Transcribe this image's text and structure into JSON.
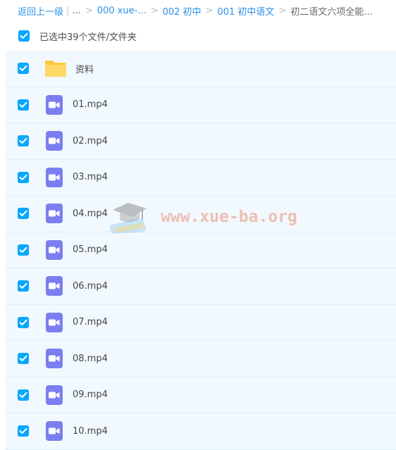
{
  "breadcrumb": {
    "back": "返回上一级",
    "bar": "|",
    "ellipsis": "...",
    "sep": ">",
    "items": [
      "000 xue-...",
      "002 初中",
      "001 初中语文"
    ],
    "current": "初二语文六项全能..."
  },
  "selection": {
    "label": "已选中39个文件/文件夹",
    "checked": true
  },
  "files": [
    {
      "name": "资料",
      "type": "folder",
      "checked": true
    },
    {
      "name": "01.mp4",
      "type": "video",
      "checked": true
    },
    {
      "name": "02.mp4",
      "type": "video",
      "checked": true
    },
    {
      "name": "03.mp4",
      "type": "video",
      "checked": true
    },
    {
      "name": "04.mp4",
      "type": "video",
      "checked": true
    },
    {
      "name": "05.mp4",
      "type": "video",
      "checked": true
    },
    {
      "name": "06.mp4",
      "type": "video",
      "checked": true
    },
    {
      "name": "07.mp4",
      "type": "video",
      "checked": true
    },
    {
      "name": "08.mp4",
      "type": "video",
      "checked": true
    },
    {
      "name": "09.mp4",
      "type": "video",
      "checked": true
    },
    {
      "name": "10.mp4",
      "type": "video",
      "checked": true
    }
  ],
  "watermark": {
    "text": "www.xue-ba.org",
    "icon": "graduation-cap-icon"
  },
  "colors": {
    "accent": "#06a7ff",
    "link": "#2a8fe8",
    "row_bg": "#f1f9fe",
    "video_icon": "#7b7ef0",
    "folder_icon": "#ffd04c"
  }
}
